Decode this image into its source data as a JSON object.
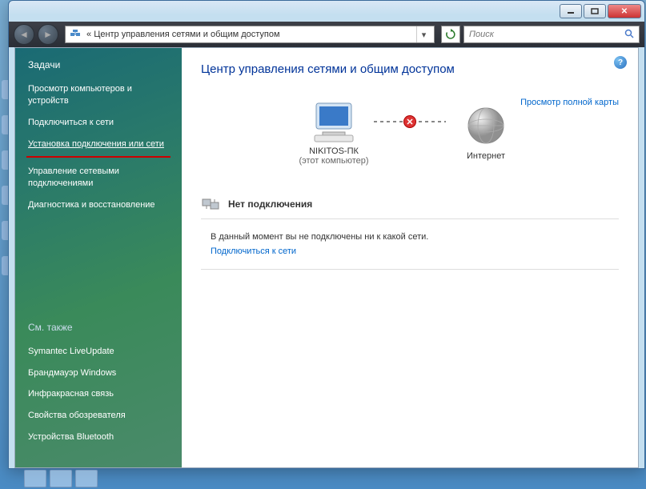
{
  "window": {
    "breadcrumb_prefix": "«",
    "breadcrumb": "Центр управления сетями и общим доступом",
    "search_placeholder": "Поиск"
  },
  "sidebar": {
    "header": "Задачи",
    "links": [
      "Просмотр компьютеров и устройств",
      "Подключиться к сети",
      "Установка подключения или сети",
      "Управление сетевыми подключениями",
      "Диагностика и восстановление"
    ],
    "see_also_header": "См. также",
    "see_also": [
      "Symantec LiveUpdate",
      "Брандмауэр Windows",
      "Инфракрасная связь",
      "Свойства обозревателя",
      "Устройства Bluetooth"
    ]
  },
  "main": {
    "title": "Центр управления сетями и общим доступом",
    "map_link": "Просмотр полной карты",
    "computer_name": "NIKITOS-ПК",
    "computer_sub": "(этот компьютер)",
    "internet_label": "Интернет",
    "status_text": "Нет подключения",
    "message": "В данный момент вы не подключены ни к какой сети.",
    "connect_link": "Подключиться к сети"
  }
}
